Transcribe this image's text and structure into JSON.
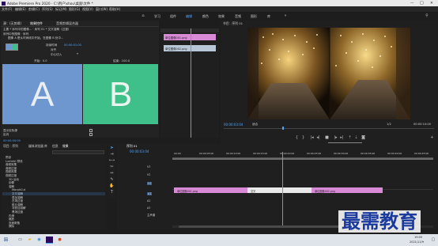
{
  "titlebar": {
    "title": "Adobe Premiere Pro 2020 - C:\\用户\\shou\\桌面\\文件 *",
    "min": "—",
    "max": "□",
    "close": "✕"
  },
  "menubar": [
    "文件(F)",
    "编辑(E)",
    "剪辑(C)",
    "序列(S)",
    "标记(M)",
    "图形(G)",
    "视图(V)",
    "窗口(W)",
    "帮助(H)"
  ],
  "workspaces": [
    "学习",
    "组件",
    "编辑",
    "颜色",
    "效果",
    "音频",
    "图形",
    "库"
  ],
  "effect_controls": {
    "tabs": [
      "源：(无剪辑)",
      "效果控件",
      "音频剪辑混合器"
    ],
    "subtitle": "主要 * 序列中的图像... · 序列 01 * 交叉溶解（过渡）",
    "heading": "序列中的图像 · 序列",
    "desc": "图像 A 是从时间线中开始，在图像 B 处中...",
    "duration_label": "持续时间",
    "duration_value": "00:00:01:00",
    "align_label": "对齐",
    "align_value": "中心切入",
    "start_label": "开始：0.0",
    "end_label": "结束：100.0",
    "label_a": "A",
    "label_b": "B",
    "show_actual": "显示实际源",
    "reverse": "反向",
    "timecode": "00:00:00:00"
  },
  "mini_timeline": {
    "clip1": "单位图像001.png",
    "clip2": "单位图像002.png"
  },
  "program": {
    "title": "节目：序列 01",
    "timecode": "00:00:03:04",
    "fit": "适合",
    "scale": "1/2",
    "duration": "00:00:10:00",
    "tooltip": "播放-停止切换 (Space)"
  },
  "project": {
    "tabs": [
      "项目：序列",
      "媒体浏览器",
      "库",
      "信息",
      "效果"
    ],
    "items": [
      "预设",
      "Lumetri 预设",
      "音频效果",
      "音频过渡",
      "视频效果",
      "视频过渡",
      "3D 运动",
      "划像",
      "溶解",
      "MorphCut",
      "交叉溶解",
      "叠加溶解",
      "白场过渡",
      "胶片溶解",
      "非叠加溶解",
      "黑场过渡",
      "内滑",
      "缩放",
      "页面剥落",
      "擦除"
    ]
  },
  "timeline": {
    "tab": "序列 01",
    "timecode": "00:00:03:04",
    "ruler": [
      "00:00",
      "00:00:05:00",
      "00:00:10:00",
      "00:00:15:00",
      "00:00:20:00",
      "00:00:25:00",
      "00:00:30:00",
      "00:00:35:00",
      "00:00:40:00",
      "00:00:45:00"
    ],
    "tracks": [
      "V3",
      "V2",
      "V1",
      "A1",
      "A2",
      "A3"
    ],
    "master": "主声道",
    "clip_a": "单位图像001.png",
    "clip_b": "单位图像002.png",
    "transition": "交叉"
  },
  "taskbar": {
    "search": "在这里输入你要搜索的内容",
    "time": "19:05",
    "date": "2021/11/9"
  },
  "watermark": "最需教育",
  "colors": {
    "accent": "#2d8ceb",
    "clip": "#d98ad6",
    "a_block": "#6f97cf",
    "b_block": "#3fc08a",
    "timecode": "#3a8fe8"
  }
}
